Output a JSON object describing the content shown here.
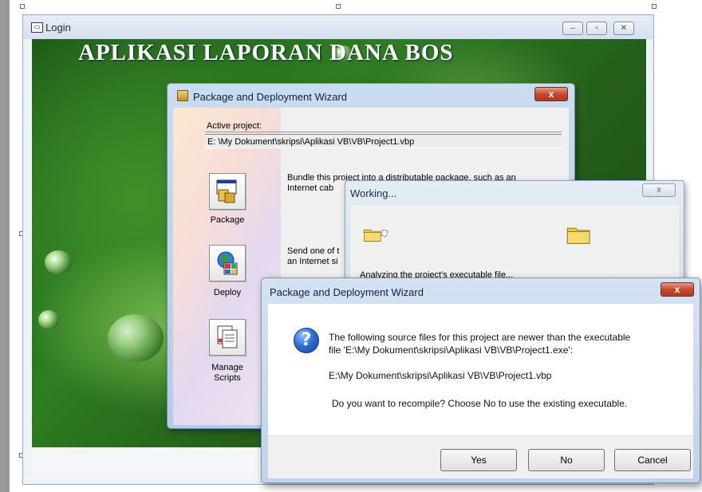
{
  "login_window": {
    "title": "Login",
    "app_title": "APLIKASI LAPORAN DANA BOS"
  },
  "wizard_window": {
    "title": "Package and Deployment Wizard",
    "close_label": "x",
    "active_project_label": "Active project:",
    "active_project_path": "E: \\My Dokument\\skripsi\\Aplikasi VB\\VB\\Project1.vbp",
    "package": {
      "label": "Package",
      "description_line1": "Bundle this project into a distributable package, such as an",
      "description_line2": "Internet cab"
    },
    "deploy": {
      "label": "Deploy",
      "description_line1": "Send one of t",
      "description_line2": "an Internet si"
    },
    "manage": {
      "label_line1": "Manage",
      "label_line2": "Scripts"
    }
  },
  "working_window": {
    "title": "Working...",
    "close_label": "x",
    "status_text": "Analyzing the project's executable file..."
  },
  "dialog": {
    "title": "Package and Deployment Wizard",
    "close_label": "x",
    "message_line1": "The following source files for this project are newer than the executable",
    "message_line2": "file 'E:\\My Dokument\\skripsi\\Aplikasi VB\\VB\\Project1.exe':",
    "file_path": "E:\\My Dokument\\skripsi\\Aplikasi VB\\VB\\Project1.vbp",
    "question": "Do you want to recompile? Choose No to use the existing executable.",
    "buttons": {
      "yes": "Yes",
      "no": "No",
      "cancel": "Cancel"
    }
  },
  "icons": [
    "form-icon",
    "package-icon",
    "deploy-icon",
    "manage-scripts-icon",
    "folder-icon",
    "question-icon"
  ],
  "colors": {
    "form_background": "#2f7d22",
    "dialog_close": "#c34a30",
    "question_icon": "#2f6fd8"
  }
}
